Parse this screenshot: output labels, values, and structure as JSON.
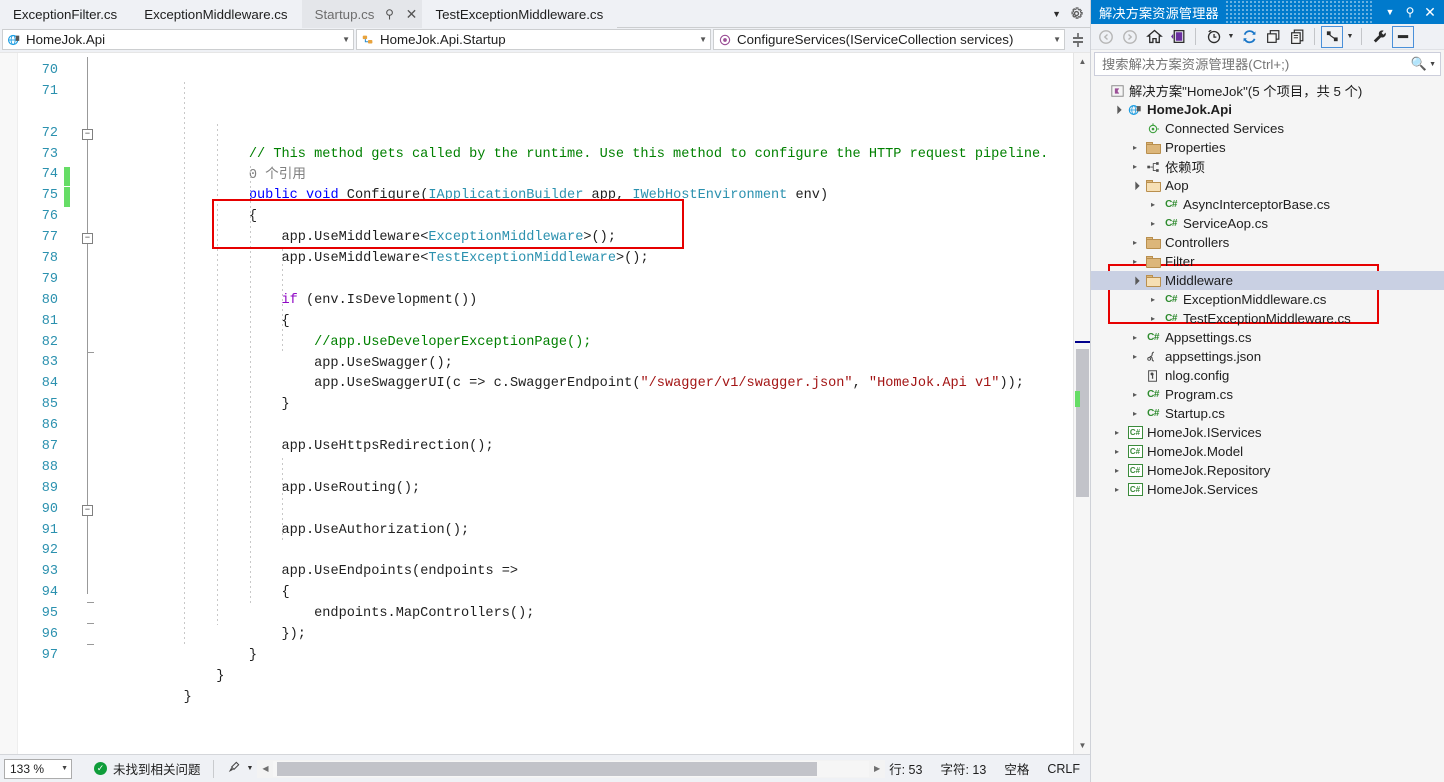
{
  "window": {
    "tabs": [
      {
        "label": "ExceptionFilter.cs",
        "active": false
      },
      {
        "label": "ExceptionMiddleware.cs",
        "active": false
      },
      {
        "label": "Startup.cs",
        "active": true,
        "pin": "⚲",
        "close": "✕"
      },
      {
        "label": "TestExceptionMiddleware.cs",
        "active": false
      }
    ],
    "tab_overflow_icon": "chevron-down-icon",
    "tab_settings_icon": "gear-icon"
  },
  "navbar": {
    "project": "HomeJok.Api",
    "type": "HomeJok.Api.Startup",
    "member": "ConfigureServices(IServiceCollection services)",
    "split_icon": "split-editor-icon"
  },
  "editor": {
    "first_line_number": 70,
    "line_numbers": [
      70,
      71,
      72,
      73,
      74,
      75,
      76,
      77,
      78,
      79,
      80,
      81,
      82,
      83,
      84,
      85,
      86,
      87,
      88,
      89,
      90,
      91,
      92,
      93,
      94,
      95,
      96,
      97
    ],
    "changed_lines": [
      74,
      75
    ],
    "fold_lines": [
      72,
      77,
      90
    ],
    "highlight_box_label": "red-highlight-middleware-calls",
    "lines": [
      {
        "n": 70,
        "tokens": []
      },
      {
        "n": 71,
        "tokens": [
          {
            "t": "                  ",
            "c": "c-pun"
          },
          {
            "t": "// This method gets called by the runtime. Use this method to configure the HTTP request pipeline.",
            "c": "c-com"
          }
        ]
      },
      {
        "n": "ref",
        "tokens": [
          {
            "t": "                  ",
            "c": "c-pun"
          },
          {
            "t": "0 个引用",
            "c": "c-ref"
          }
        ]
      },
      {
        "n": 72,
        "tokens": [
          {
            "t": "                  ",
            "c": "c-pun"
          },
          {
            "t": "public",
            "c": "c-kw"
          },
          {
            "t": " ",
            "c": "c-pun"
          },
          {
            "t": "void",
            "c": "c-kw"
          },
          {
            "t": " ",
            "c": "c-pun"
          },
          {
            "t": "Configure",
            "c": "c-id"
          },
          {
            "t": "(",
            "c": "c-pun"
          },
          {
            "t": "IApplicationBuilder",
            "c": "c-typ"
          },
          {
            "t": " app, ",
            "c": "c-id"
          },
          {
            "t": "IWebHostEnvironment",
            "c": "c-typ"
          },
          {
            "t": " env",
            "c": "c-id"
          },
          {
            "t": ")",
            "c": "c-pun"
          }
        ]
      },
      {
        "n": 73,
        "tokens": [
          {
            "t": "                  {",
            "c": "c-pun"
          }
        ]
      },
      {
        "n": 74,
        "tokens": [
          {
            "t": "                      app",
            "c": "c-id"
          },
          {
            "t": ".",
            "c": "c-pun"
          },
          {
            "t": "UseMiddleware",
            "c": "c-id"
          },
          {
            "t": "<",
            "c": "c-pun"
          },
          {
            "t": "ExceptionMiddleware",
            "c": "c-typ"
          },
          {
            "t": ">();",
            "c": "c-pun"
          }
        ]
      },
      {
        "n": 75,
        "tokens": [
          {
            "t": "                      app",
            "c": "c-id"
          },
          {
            "t": ".",
            "c": "c-pun"
          },
          {
            "t": "UseMiddleware",
            "c": "c-id"
          },
          {
            "t": "<",
            "c": "c-pun"
          },
          {
            "t": "TestExceptionMiddleware",
            "c": "c-typ"
          },
          {
            "t": ">();",
            "c": "c-pun"
          }
        ]
      },
      {
        "n": 76,
        "tokens": []
      },
      {
        "n": 77,
        "tokens": [
          {
            "t": "                      ",
            "c": "c-pun"
          },
          {
            "t": "if",
            "c": "c-ctl"
          },
          {
            "t": " (env",
            "c": "c-id"
          },
          {
            "t": ".",
            "c": "c-pun"
          },
          {
            "t": "IsDevelopment",
            "c": "c-id"
          },
          {
            "t": "())",
            "c": "c-pun"
          }
        ]
      },
      {
        "n": 78,
        "tokens": [
          {
            "t": "                      {",
            "c": "c-pun"
          }
        ]
      },
      {
        "n": 79,
        "tokens": [
          {
            "t": "                          ",
            "c": "c-pun"
          },
          {
            "t": "//app.UseDeveloperExceptionPage();",
            "c": "c-com"
          }
        ]
      },
      {
        "n": 80,
        "tokens": [
          {
            "t": "                          app",
            "c": "c-id"
          },
          {
            "t": ".",
            "c": "c-pun"
          },
          {
            "t": "UseSwagger",
            "c": "c-id"
          },
          {
            "t": "();",
            "c": "c-pun"
          }
        ]
      },
      {
        "n": 81,
        "tokens": [
          {
            "t": "                          app",
            "c": "c-id"
          },
          {
            "t": ".",
            "c": "c-pun"
          },
          {
            "t": "UseSwaggerUI",
            "c": "c-id"
          },
          {
            "t": "(c => c",
            "c": "c-id"
          },
          {
            "t": ".",
            "c": "c-pun"
          },
          {
            "t": "SwaggerEndpoint",
            "c": "c-id"
          },
          {
            "t": "(",
            "c": "c-pun"
          },
          {
            "t": "\"/swagger/v1/swagger.json\"",
            "c": "c-str"
          },
          {
            "t": ", ",
            "c": "c-pun"
          },
          {
            "t": "\"HomeJok.Api v1\"",
            "c": "c-str"
          },
          {
            "t": "));",
            "c": "c-pun"
          }
        ]
      },
      {
        "n": 82,
        "tokens": [
          {
            "t": "                      }",
            "c": "c-pun"
          }
        ]
      },
      {
        "n": 83,
        "tokens": []
      },
      {
        "n": 84,
        "tokens": [
          {
            "t": "                      app",
            "c": "c-id"
          },
          {
            "t": ".",
            "c": "c-pun"
          },
          {
            "t": "UseHttpsRedirection",
            "c": "c-id"
          },
          {
            "t": "();",
            "c": "c-pun"
          }
        ]
      },
      {
        "n": 85,
        "tokens": []
      },
      {
        "n": 86,
        "tokens": [
          {
            "t": "                      app",
            "c": "c-id"
          },
          {
            "t": ".",
            "c": "c-pun"
          },
          {
            "t": "UseRouting",
            "c": "c-id"
          },
          {
            "t": "();",
            "c": "c-pun"
          }
        ]
      },
      {
        "n": 87,
        "tokens": []
      },
      {
        "n": 88,
        "tokens": [
          {
            "t": "                      app",
            "c": "c-id"
          },
          {
            "t": ".",
            "c": "c-pun"
          },
          {
            "t": "UseAuthorization",
            "c": "c-id"
          },
          {
            "t": "();",
            "c": "c-pun"
          }
        ]
      },
      {
        "n": 89,
        "tokens": []
      },
      {
        "n": 90,
        "tokens": [
          {
            "t": "                      app",
            "c": "c-id"
          },
          {
            "t": ".",
            "c": "c-pun"
          },
          {
            "t": "UseEndpoints",
            "c": "c-id"
          },
          {
            "t": "(endpoints =>",
            "c": "c-id"
          }
        ]
      },
      {
        "n": 91,
        "tokens": [
          {
            "t": "                      {",
            "c": "c-pun"
          }
        ]
      },
      {
        "n": 92,
        "tokens": [
          {
            "t": "                          endpoints",
            "c": "c-id"
          },
          {
            "t": ".",
            "c": "c-pun"
          },
          {
            "t": "MapControllers",
            "c": "c-id"
          },
          {
            "t": "();",
            "c": "c-pun"
          }
        ]
      },
      {
        "n": 93,
        "tokens": [
          {
            "t": "                      });",
            "c": "c-pun"
          }
        ]
      },
      {
        "n": 94,
        "tokens": [
          {
            "t": "                  }",
            "c": "c-pun"
          }
        ]
      },
      {
        "n": 95,
        "tokens": [
          {
            "t": "              }",
            "c": "c-pun"
          }
        ]
      },
      {
        "n": 96,
        "tokens": [
          {
            "t": "          }",
            "c": "c-pun"
          }
        ]
      },
      {
        "n": 97,
        "tokens": []
      }
    ]
  },
  "statusbar": {
    "zoom": "133 %",
    "issue_text": "未找到相关问题",
    "issue_icon": "check-circle-icon",
    "brush_icon": "brush-icon",
    "line_label": "行: 53",
    "char_label": "字符: 13",
    "spaces_label": "空格",
    "eol_label": "CRLF"
  },
  "solution_explorer": {
    "title": "解决方案资源管理器",
    "window_buttons": [
      "chevron-down-icon",
      "pin-icon",
      "close-icon"
    ],
    "toolbar_icons": [
      "back-icon",
      "forward-icon",
      "home-icon",
      "sync-with-active-document-icon",
      "pending-changes-icon",
      "refresh-icon",
      "collapse-all-icon",
      "show-all-files-icon",
      "view-code-icon",
      "properties-icon",
      "preview-selected-items-icon"
    ],
    "search_placeholder": "搜索解决方案资源管理器(Ctrl+;)",
    "search_value": "",
    "tree": [
      {
        "depth": 0,
        "exp": "",
        "icon": "solution-icon",
        "label": "解决方案\"HomeJok\"(5 个项目，共 5 个)",
        "bold": false
      },
      {
        "depth": 1,
        "exp": "▾",
        "icon": "web-project-icon",
        "label": "HomeJok.Api",
        "bold": true
      },
      {
        "depth": 2,
        "exp": "",
        "icon": "connected-services-icon",
        "label": "Connected Services",
        "bold": false
      },
      {
        "depth": 2,
        "exp": "▸",
        "icon": "properties-folder-icon",
        "label": "Properties",
        "bold": false
      },
      {
        "depth": 2,
        "exp": "▸",
        "icon": "dependencies-icon",
        "label": "依赖项",
        "bold": false
      },
      {
        "depth": 2,
        "exp": "▾",
        "icon": "folder-open-icon",
        "label": "Aop",
        "bold": false
      },
      {
        "depth": 3,
        "exp": "▸",
        "icon": "csharp-file-icon",
        "label": "AsyncInterceptorBase.cs",
        "bold": false
      },
      {
        "depth": 3,
        "exp": "▸",
        "icon": "csharp-file-icon",
        "label": "ServiceAop.cs",
        "bold": false
      },
      {
        "depth": 2,
        "exp": "▸",
        "icon": "folder-icon",
        "label": "Controllers",
        "bold": false
      },
      {
        "depth": 2,
        "exp": "▸",
        "icon": "folder-icon",
        "label": "Filter",
        "bold": false
      },
      {
        "depth": 2,
        "exp": "▾",
        "icon": "folder-open-icon",
        "label": "Middleware",
        "bold": false,
        "selected": true
      },
      {
        "depth": 3,
        "exp": "▸",
        "icon": "csharp-file-icon",
        "label": "ExceptionMiddleware.cs",
        "bold": false
      },
      {
        "depth": 3,
        "exp": "▸",
        "icon": "csharp-file-icon",
        "label": "TestExceptionMiddleware.cs",
        "bold": false
      },
      {
        "depth": 2,
        "exp": "▸",
        "icon": "csharp-file-icon",
        "label": "Appsettings.cs",
        "bold": false
      },
      {
        "depth": 2,
        "exp": "▸",
        "icon": "json-file-icon",
        "label": "appsettings.json",
        "bold": false
      },
      {
        "depth": 2,
        "exp": "",
        "icon": "config-file-icon",
        "label": "nlog.config",
        "bold": false
      },
      {
        "depth": 2,
        "exp": "▸",
        "icon": "csharp-file-icon",
        "label": "Program.cs",
        "bold": false
      },
      {
        "depth": 2,
        "exp": "▸",
        "icon": "csharp-file-icon",
        "label": "Startup.cs",
        "bold": false
      },
      {
        "depth": 1,
        "exp": "▸",
        "icon": "csharp-project-icon",
        "label": "HomeJok.IServices",
        "bold": false
      },
      {
        "depth": 1,
        "exp": "▸",
        "icon": "csharp-project-icon",
        "label": "HomeJok.Model",
        "bold": false
      },
      {
        "depth": 1,
        "exp": "▸",
        "icon": "csharp-project-icon",
        "label": "HomeJok.Repository",
        "bold": false
      },
      {
        "depth": 1,
        "exp": "▸",
        "icon": "csharp-project-icon",
        "label": "HomeJok.Services",
        "bold": false
      }
    ],
    "selection_highlight_label": "red-highlight-middleware-folder"
  },
  "colors": {
    "accent": "#007acc",
    "highlight_red": "#e60000",
    "change_green": "#66dd66",
    "selection": "#c9d0e3"
  }
}
